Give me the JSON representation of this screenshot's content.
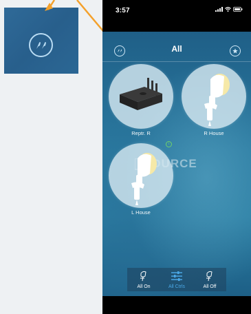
{
  "colors": {
    "accent_orange": "#f4a12b",
    "active_tab": "#4aa8e6",
    "inactive_tab": "#ffffff"
  },
  "callout": {
    "icon": "lights-group-icon"
  },
  "status_bar": {
    "time": "3:57",
    "icons": [
      "signal-icon",
      "wifi-icon",
      "battery-icon"
    ]
  },
  "header": {
    "title": "All",
    "left_icon": "lights-group-icon",
    "right_icon": "star-icon"
  },
  "devices": [
    {
      "label": "Reptr. R",
      "icon": "repeater-hub-icon"
    },
    {
      "label": "R House",
      "icon": "spotlight-icon"
    },
    {
      "label": "L House",
      "icon": "spotlight-icon"
    }
  ],
  "watermark": {
    "text": "SOURCE"
  },
  "bottom_tabs": [
    {
      "label": "All On",
      "icon": "spotlight-on-icon",
      "active": false
    },
    {
      "label": "All Ctrls",
      "icon": "sliders-icon",
      "active": true
    },
    {
      "label": "All Off",
      "icon": "spotlight-off-icon",
      "active": false
    }
  ]
}
